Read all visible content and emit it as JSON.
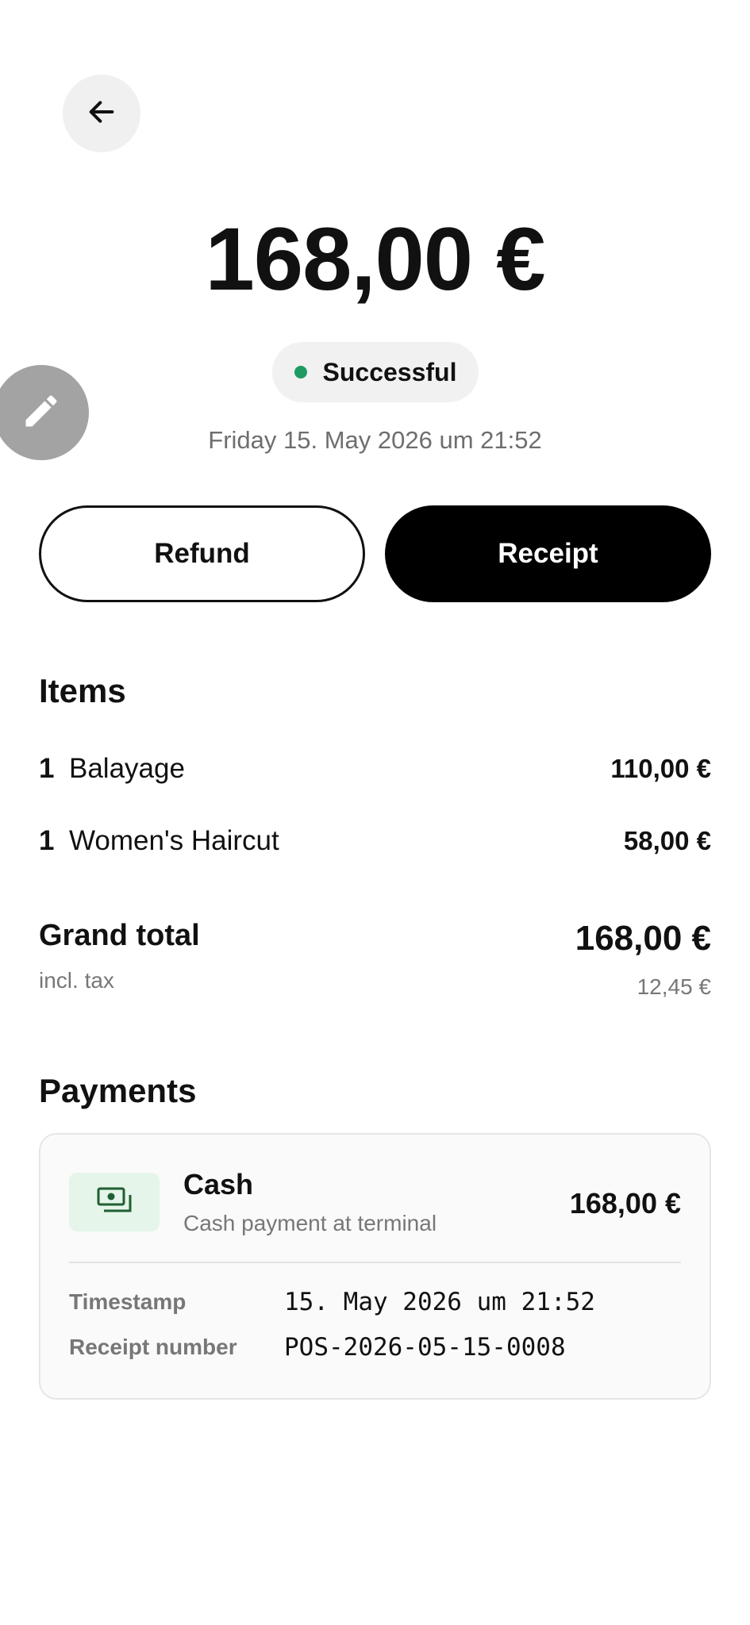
{
  "header": {
    "back_icon": "arrow-left-icon"
  },
  "transaction": {
    "amount": "168,00 €",
    "status": "Successful",
    "status_color": "#1e9b62",
    "date": "Friday 15. May 2026 um 21:52"
  },
  "edit_fab": {
    "icon": "pencil-icon",
    "color": "#a3a3a3"
  },
  "actions": {
    "refund_label": "Refund",
    "receipt_label": "Receipt"
  },
  "items": {
    "title": "Items",
    "rows": [
      {
        "qty": "1",
        "name": "Balayage",
        "price": "110,00 €"
      },
      {
        "qty": "1",
        "name": "Women's Haircut",
        "price": "58,00 €"
      }
    ]
  },
  "totals": {
    "grand_total_label": "Grand total",
    "grand_total": "168,00 €",
    "tax_label": "incl. tax",
    "tax": "12,45 €"
  },
  "payments": {
    "title": "Payments",
    "entries": [
      {
        "icon": "cash-icon",
        "method": "Cash",
        "description": "Cash payment at terminal",
        "amount": "168,00 €",
        "timestamp_label": "Timestamp",
        "timestamp": "15. May 2026 um 21:52",
        "receipt_label": "Receipt number",
        "receipt_number": "POS-2026-05-15-0008"
      }
    ]
  }
}
